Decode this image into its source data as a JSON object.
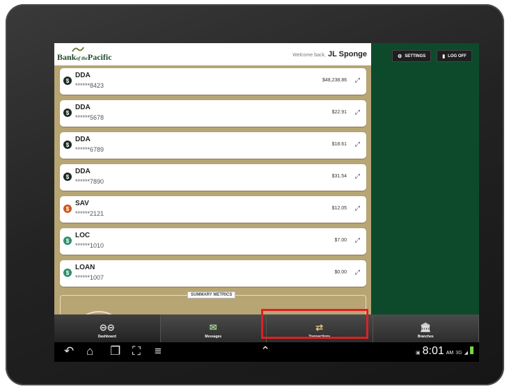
{
  "header": {
    "logo_text": "Bank of the Pacific",
    "logo_pre": "Bank",
    "logo_of": "of the",
    "logo_post": "Pacific",
    "welcome_label": "Welcome back,",
    "user_name": "JL Sponge"
  },
  "top_buttons": {
    "settings": "SETTINGS",
    "logoff": "LOG OFF"
  },
  "accounts": [
    {
      "type": "DDA",
      "number": "******8423",
      "balance": "$48,238.86",
      "icon_color": "#1d2a26"
    },
    {
      "type": "DDA",
      "number": "******5678",
      "balance": "$22.91",
      "icon_color": "#1d2a26"
    },
    {
      "type": "DDA",
      "number": "******6789",
      "balance": "$18.61",
      "icon_color": "#1d2a26"
    },
    {
      "type": "DDA",
      "number": "******7890",
      "balance": "$31.54",
      "icon_color": "#1d2a26"
    },
    {
      "type": "SAV",
      "number": "******2121",
      "balance": "$12.05",
      "icon_color": "#c85a1e"
    },
    {
      "type": "LOC",
      "number": "******1010",
      "balance": "$7.00",
      "icon_color": "#2f8f6a"
    },
    {
      "type": "LOAN",
      "number": "******1007",
      "balance": "$0.00",
      "icon_color": "#2f8f6a"
    }
  ],
  "summary": {
    "label": "SUMMARY METRICS"
  },
  "tabs": [
    {
      "label": "Dashboard",
      "icon": "glasses-icon"
    },
    {
      "label": "Messages",
      "icon": "envelope-icon"
    },
    {
      "label": "Transactions",
      "icon": "transfer-arrows-icon"
    },
    {
      "label": "Branches",
      "icon": "bank-building-icon"
    }
  ],
  "status_bar": {
    "time": "8:01",
    "ampm": "AM",
    "network": "3G"
  },
  "colors": {
    "brand_green": "#0d4a2c",
    "account_panel": "#b8a574",
    "highlight": "#e02020"
  }
}
